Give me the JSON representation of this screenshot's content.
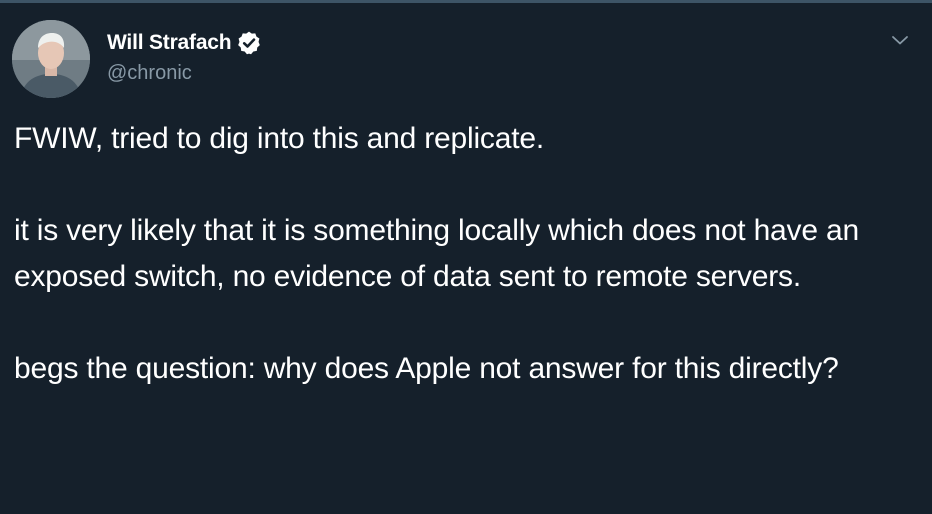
{
  "author": {
    "display_name": "Will Strafach",
    "handle": "@chronic",
    "verified": true,
    "avatar_icon": "profile-photo"
  },
  "tweet": {
    "paragraphs": [
      "FWIW, tried to dig into this and replicate.",
      "it is very likely that it is something locally which does not have an exposed switch, no evidence of data sent to remote servers.",
      "begs the question: why does Apple not answer for this directly?"
    ]
  },
  "icons": {
    "verified": "verified-badge-icon",
    "menu": "chevron-down-icon"
  },
  "colors": {
    "background": "#15202b",
    "text": "#ffffff",
    "secondary_text": "#8899a6",
    "border": "#3d5466"
  }
}
